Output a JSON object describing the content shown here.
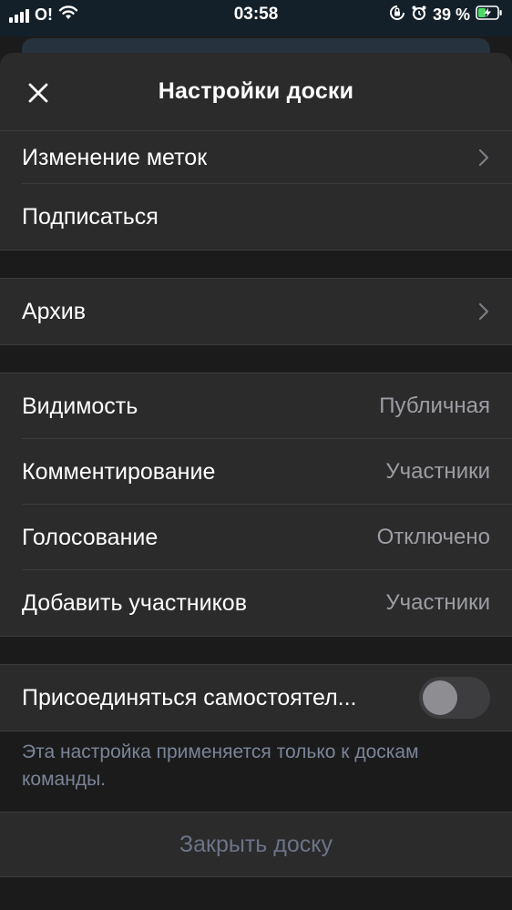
{
  "status_bar": {
    "carrier": "O!",
    "time": "03:58",
    "battery": "39 %",
    "icons": [
      "signal-icon",
      "wifi-icon",
      "orientation-lock-icon",
      "alarm-icon",
      "battery-charging-icon"
    ]
  },
  "sheet": {
    "title": "Настройки доски",
    "close_icon": "close-icon"
  },
  "group1": {
    "items": [
      {
        "label": "Изменение меток",
        "icon": "chevron-right-icon"
      },
      {
        "label": "Подписаться"
      }
    ]
  },
  "group2": {
    "items": [
      {
        "label": "Архив",
        "icon": "chevron-right-icon"
      }
    ]
  },
  "group3": {
    "items": [
      {
        "label": "Видимость",
        "value": "Публичная"
      },
      {
        "label": "Комментирование",
        "value": "Участники"
      },
      {
        "label": "Голосование",
        "value": "Отключено"
      },
      {
        "label": "Добавить участников",
        "value": "Участники"
      }
    ]
  },
  "group4": {
    "items": [
      {
        "label": "Присоединяться самостоятел...",
        "toggle_on": false
      }
    ],
    "footnote": "Эта настройка применяется только к доскам команды."
  },
  "close_board": {
    "label": "Закрыть доску"
  },
  "colors": {
    "background": "#1b1b1c",
    "row_bg": "#2b2b2c",
    "secondary_text": "#9d9ea3",
    "disabled_text": "#6d7488",
    "status_bar_bg": "#142029",
    "battery_green": "#4cd964"
  }
}
